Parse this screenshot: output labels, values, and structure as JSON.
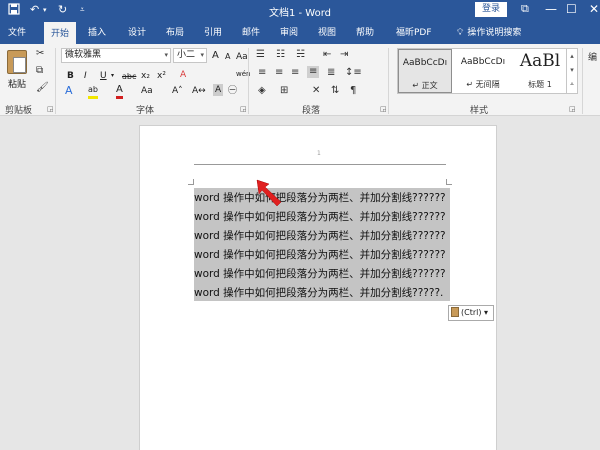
{
  "titlebar": {
    "title": "文档1 - Word",
    "login": "登录",
    "save_icon": "save-icon",
    "undo_icon": "undo-icon",
    "redo_icon": "redo-icon",
    "customize_icon": "customize-icon",
    "restore_icon": "restore-icon",
    "minimize": "—",
    "maximize": "☐",
    "close": "✕"
  },
  "tabs": [
    {
      "label": "文件"
    },
    {
      "label": "开始"
    },
    {
      "label": "插入"
    },
    {
      "label": "设计"
    },
    {
      "label": "布局"
    },
    {
      "label": "引用"
    },
    {
      "label": "邮件"
    },
    {
      "label": "审阅"
    },
    {
      "label": "视图"
    },
    {
      "label": "帮助"
    },
    {
      "label": "福昕PDF"
    }
  ],
  "tell_me": {
    "icon": "lightbulb-icon",
    "label": "操作说明搜索"
  },
  "ribbon": {
    "clipboard": {
      "paste": "粘贴",
      "group": "剪贴板"
    },
    "font": {
      "name": "微软雅黑",
      "size": "小二",
      "grow": "A",
      "shrink": "A",
      "case": "Aa",
      "clear": "A",
      "wen": "wén",
      "bold": "B",
      "italic": "I",
      "underline": "U",
      "strike": "abc",
      "sub": "x₂",
      "sup": "x²",
      "text_effect": "A",
      "highlight": "ab",
      "font_color": "A",
      "aa": "Aa",
      "char_shade": "A",
      "group": "字体"
    },
    "paragraph": {
      "group": "段落"
    },
    "styles": {
      "items": [
        {
          "sample": "AaBbCcDı",
          "name": "↵ 正文"
        },
        {
          "sample": "AaBbCcDı",
          "name": "↵ 无间隔"
        },
        {
          "sample": "AaBl",
          "name": "标题 1"
        }
      ],
      "group": "样式",
      "edit_partial": "编"
    }
  },
  "document": {
    "header_mark": "1",
    "lines": [
      "word 操作中如何把段落分为两栏、并加分割线??????",
      "word 操作中如何把段落分为两栏、并加分割线??????",
      "word 操作中如何把段落分为两栏、并加分割线??????",
      "word 操作中如何把段落分为两栏、并加分割线??????",
      "word 操作中如何把段落分为两栏、并加分割线??????",
      "word 操作中如何把段落分为两栏、并加分割线?????."
    ],
    "paste_options": "(Ctrl) ▾",
    "pointer_color": "#e02020"
  },
  "colors": {
    "accent": "#2b579a",
    "selection": "#c4c4c4"
  }
}
